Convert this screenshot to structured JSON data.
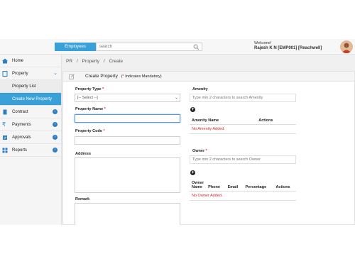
{
  "header": {
    "scope_button": "Employees",
    "search_placeholder": "search",
    "welcome": "Welcome!",
    "user": "Rajesh K N [EMP001] [Reachwell]"
  },
  "sidebar": {
    "items": [
      {
        "label": "Home"
      },
      {
        "label": "Property"
      },
      {
        "label": "Property List"
      },
      {
        "label": "Create New Property"
      },
      {
        "label": "Contract"
      },
      {
        "label": "Payments"
      },
      {
        "label": "Approvals"
      },
      {
        "label": "Reports"
      }
    ]
  },
  "breadcrumb": [
    "PR",
    "/",
    "Property",
    "/",
    "Create"
  ],
  "panel": {
    "title": "Create Property",
    "mandatory_note": "Indicates Mandatory)",
    "mandatory_open": "(",
    "mandatory_star": "*"
  },
  "form": {
    "property_type_label": "Property Type",
    "property_type_value": "[-- Select --]",
    "property_name_label": "Property Name",
    "property_code_label": "Property Code",
    "address_label": "Address",
    "remark_label": "Remark",
    "star": "*"
  },
  "amenity": {
    "label": "Amenity",
    "placeholder": "Type min 2 characters to search Amenity",
    "columns": [
      "Amenity Name",
      "Actions"
    ],
    "empty": "No Amenity Added."
  },
  "owner": {
    "label": "Owner",
    "placeholder": "Type min 2 characters to search Owner",
    "columns": [
      "Owner Name",
      "Phone",
      "Email",
      "Percentage",
      "Actions"
    ],
    "empty": "No Owner Added."
  },
  "colors": {
    "accent": "#3aa1d8",
    "badge": "#2f7fc0",
    "required": "#d9262c"
  }
}
